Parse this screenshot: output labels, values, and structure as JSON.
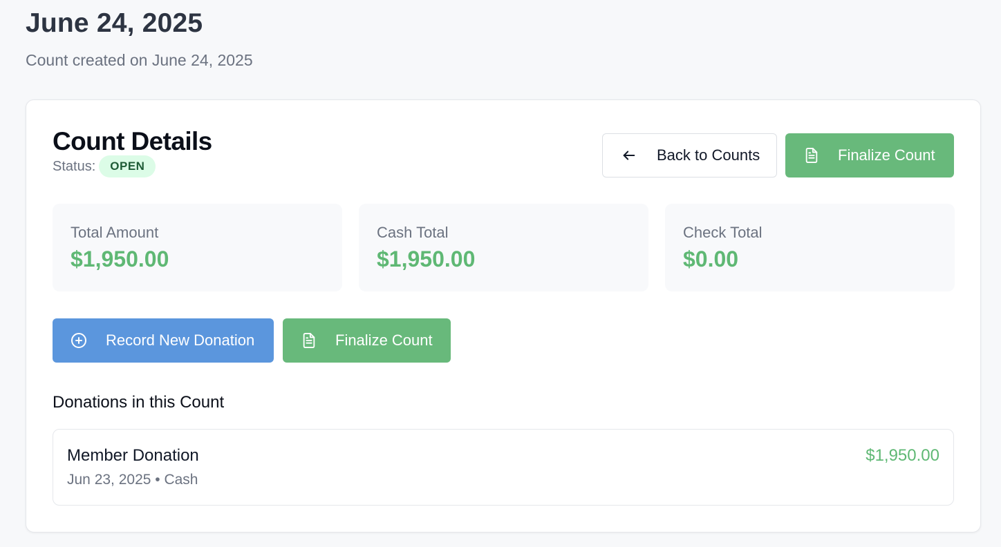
{
  "header": {
    "title": "June 24, 2025",
    "subtitle": "Count created on June 24, 2025"
  },
  "card": {
    "title": "Count Details",
    "status_label": "Status:",
    "status_value": "OPEN",
    "back_button": {
      "label": "Back to Counts",
      "icon": "arrow-left-icon"
    },
    "finalize_button": {
      "label": "Finalize Count",
      "icon": "document-icon"
    }
  },
  "stats": [
    {
      "label": "Total Amount",
      "value": "$1,950.00"
    },
    {
      "label": "Cash Total",
      "value": "$1,950.00"
    },
    {
      "label": "Check Total",
      "value": "$0.00"
    }
  ],
  "actions": {
    "record_label": "Record New Donation",
    "record_icon": "plus-circle-icon",
    "finalize_label": "Finalize Count",
    "finalize_icon": "document-icon"
  },
  "donations": {
    "heading": "Donations in this Count",
    "items": [
      {
        "name": "Member Donation",
        "meta": "Jun 23, 2025 • Cash",
        "amount": "$1,950.00"
      }
    ]
  },
  "colors": {
    "page_bg": "#f7f8fa",
    "green": "#68b97b",
    "green_text": "#5fb874",
    "blue": "#5b96dd",
    "badge_bg": "#dcfce7",
    "badge_text": "#1f5c37"
  }
}
